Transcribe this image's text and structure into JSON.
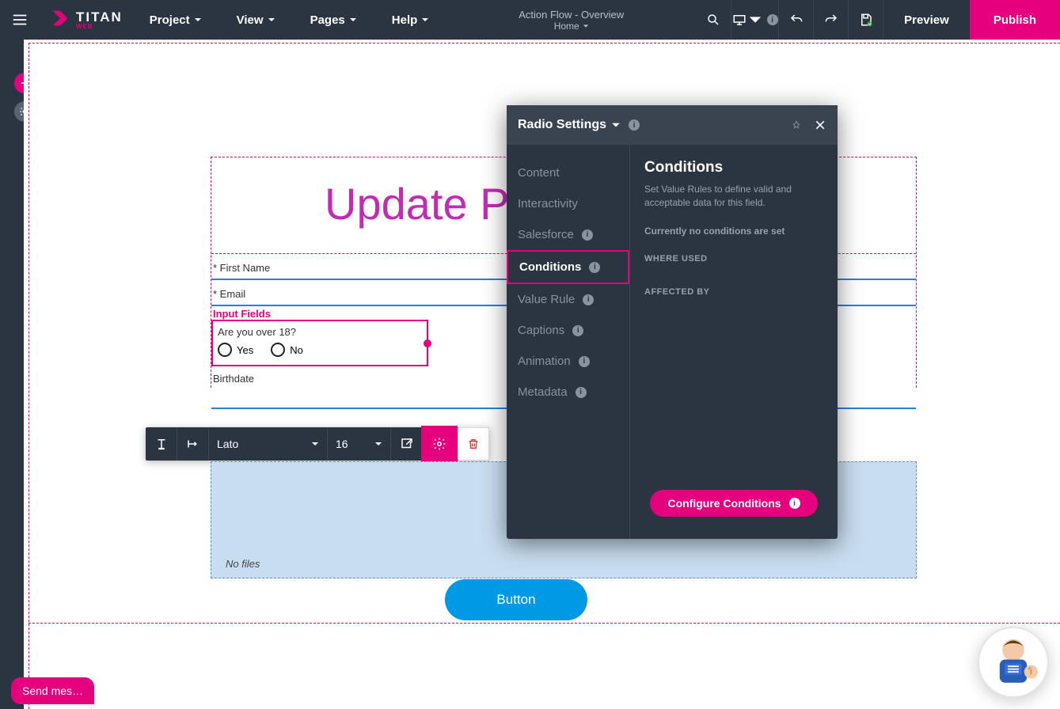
{
  "topbar": {
    "menu": [
      "Project",
      "View",
      "Pages",
      "Help"
    ],
    "center_title": "Action Flow - Overview",
    "center_sub": "Home",
    "preview": "Preview",
    "publish": "Publish",
    "logo_title": "TITAN",
    "logo_sub": "WEB"
  },
  "form": {
    "title": "Update Personal Details",
    "first_name_label": "* First Name",
    "email_label": "* Email",
    "input_fields_label": "Input Fields",
    "radio_question": "Are you over 18?",
    "radio_yes": "Yes",
    "radio_no": "No",
    "birthdate_label": "Birthdate",
    "no_files": "No files",
    "button_label": "Button"
  },
  "inline_toolbar": {
    "font": "Lato",
    "size": "16"
  },
  "popover": {
    "title": "Radio Settings",
    "nav": [
      {
        "label": "Content",
        "badge": false
      },
      {
        "label": "Interactivity",
        "badge": false
      },
      {
        "label": "Salesforce",
        "badge": true
      },
      {
        "label": "Conditions",
        "badge": true
      },
      {
        "label": "Value Rule",
        "badge": true
      },
      {
        "label": "Captions",
        "badge": true
      },
      {
        "label": "Animation",
        "badge": true
      },
      {
        "label": "Metadata",
        "badge": true
      }
    ],
    "active_index": 3,
    "content": {
      "title": "Conditions",
      "desc": "Set Value Rules to define valid and acceptable data for this field.",
      "status": "Currently no conditions are set",
      "where_used": "WHERE USED",
      "affected_by": "AFFECTED BY",
      "button": "Configure Conditions"
    }
  },
  "chat": {
    "label": "Send mes…"
  }
}
